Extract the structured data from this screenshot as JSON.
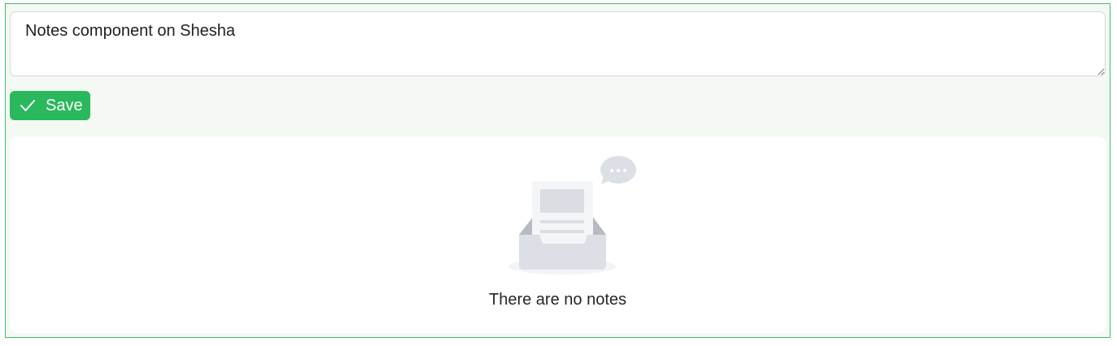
{
  "note_input": {
    "value": "Notes component on Shesha"
  },
  "actions": {
    "save_label": "Save",
    "save_icon": "check-icon"
  },
  "notes_list": {
    "empty_text": "There are no notes",
    "empty_icon": "empty-inbox-icon"
  },
  "colors": {
    "accent": "#29b85c",
    "panel_border": "#3fbf6a",
    "panel_background": "#f4f9f4"
  }
}
